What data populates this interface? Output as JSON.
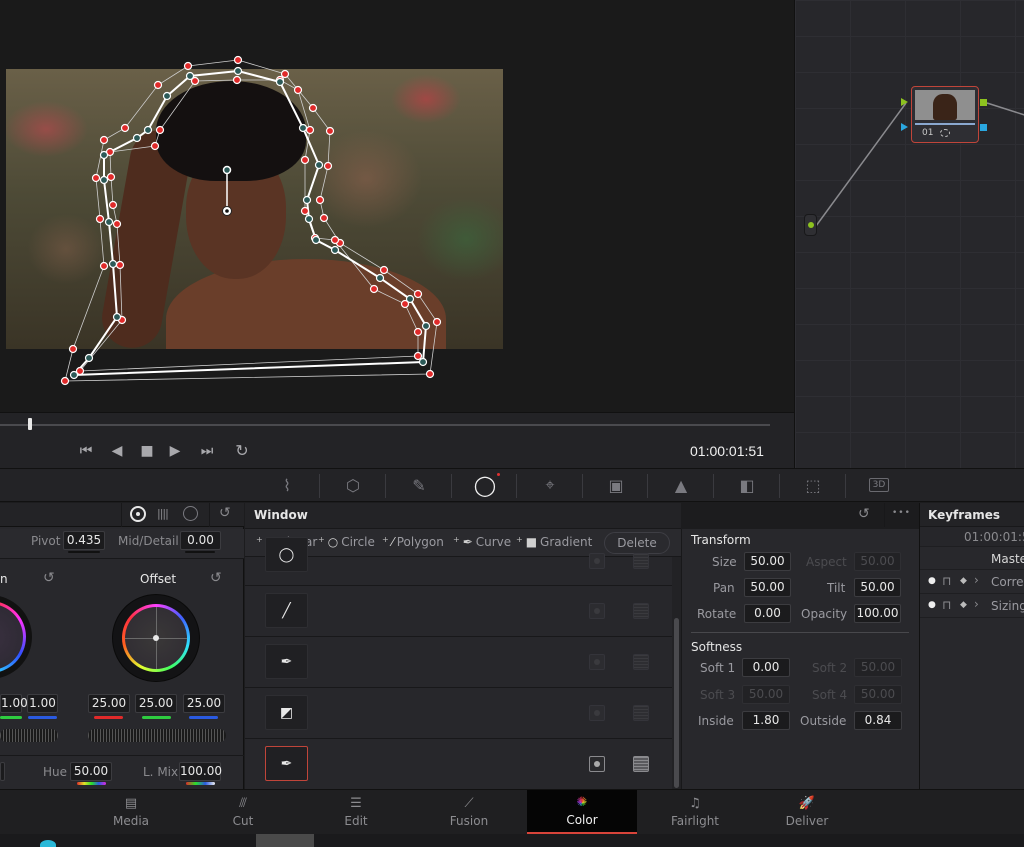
{
  "viewer": {
    "timecode": "01:00:01:51",
    "scrub_progress": 0.036,
    "transport": {
      "first_frame": "⏮",
      "prev_frame": "◀",
      "stop": "■",
      "play": "▶",
      "last_frame": "⏭",
      "loop": "↻"
    }
  },
  "node_editor": {
    "node_label": "01",
    "colors": {
      "node_border": "#c0453a",
      "port_rgb": "#8dc21f",
      "port_alpha": "#2aa7e0"
    }
  },
  "palette_toolbar": {
    "tools": [
      {
        "name": "curves",
        "glyph": "⌇"
      },
      {
        "name": "color-warper",
        "glyph": "⬡"
      },
      {
        "name": "qualifier",
        "glyph": "✎"
      },
      {
        "name": "window",
        "glyph": "◯",
        "active": true
      },
      {
        "name": "tracker",
        "glyph": "⌖"
      },
      {
        "name": "magic-mask",
        "glyph": "▣"
      },
      {
        "name": "blur",
        "glyph": "▲"
      },
      {
        "name": "key",
        "glyph": "◧"
      },
      {
        "name": "sizing",
        "glyph": "⬚"
      },
      {
        "name": "3d",
        "glyph": "3D"
      }
    ]
  },
  "primaries": {
    "pivot_label": "Pivot",
    "pivot_value": "0.435",
    "mid_detail_label": "Mid/Detail",
    "mid_detail_value": "0.00",
    "gain_label_partial": "n",
    "offset_label": "Offset",
    "gain_values": [
      "1.00",
      "1.00"
    ],
    "offset_values": [
      "25.00",
      "25.00",
      "25.00"
    ],
    "hue_label": "Hue",
    "hue_value": "50.00",
    "lmix_label": "L. Mix",
    "lmix_value": "100.00",
    "reset_glyph": "↺"
  },
  "window_panel": {
    "title": "Window",
    "tools": [
      {
        "label": "Linear",
        "glyph": "□"
      },
      {
        "label": "Circle",
        "glyph": "○"
      },
      {
        "label": "Polygon",
        "glyph": "⁄"
      },
      {
        "label": "Curve",
        "glyph": "✒"
      },
      {
        "label": "Gradient",
        "glyph": "■"
      }
    ],
    "delete_label": "Delete",
    "rows": [
      {
        "shape": "circle",
        "glyph": "◯",
        "selected": false
      },
      {
        "shape": "linear",
        "glyph": "╱",
        "selected": false
      },
      {
        "shape": "curve",
        "glyph": "✒",
        "selected": false
      },
      {
        "shape": "gradient",
        "glyph": "◩",
        "selected": false
      },
      {
        "shape": "curve",
        "glyph": "✒",
        "selected": true
      }
    ],
    "reset_glyph": "↺",
    "more_glyph": "•••"
  },
  "transform": {
    "title": "Transform",
    "size_label": "Size",
    "size": "50.00",
    "aspect_label": "Aspect",
    "aspect": "50.00",
    "pan_label": "Pan",
    "pan": "50.00",
    "tilt_label": "Tilt",
    "tilt": "50.00",
    "rotate_label": "Rotate",
    "rotate": "0.00",
    "opacity_label": "Opacity",
    "opacity": "100.00"
  },
  "softness": {
    "title": "Softness",
    "soft1_label": "Soft 1",
    "soft1": "0.00",
    "soft2_label": "Soft 2",
    "soft2": "50.00",
    "soft3_label": "Soft 3",
    "soft3": "50.00",
    "soft4_label": "Soft 4",
    "soft4": "50.00",
    "inside_label": "Inside",
    "inside": "1.80",
    "outside_label": "Outside",
    "outside": "0.84"
  },
  "keyframes": {
    "title": "Keyframes",
    "timecode": "01:00:01:5",
    "master_label": "Maste",
    "tracks": [
      {
        "label": "Corre"
      },
      {
        "label": "Sizing"
      }
    ]
  },
  "pages": [
    {
      "label": "Media",
      "glyph": "▤"
    },
    {
      "label": "Cut",
      "glyph": "⫻"
    },
    {
      "label": "Edit",
      "glyph": "☰"
    },
    {
      "label": "Fusion",
      "glyph": "⟋"
    },
    {
      "label": "Color",
      "glyph": "✺",
      "active": true
    },
    {
      "label": "Fairlight",
      "glyph": "♫"
    },
    {
      "label": "Deliver",
      "glyph": "🚀"
    }
  ]
}
